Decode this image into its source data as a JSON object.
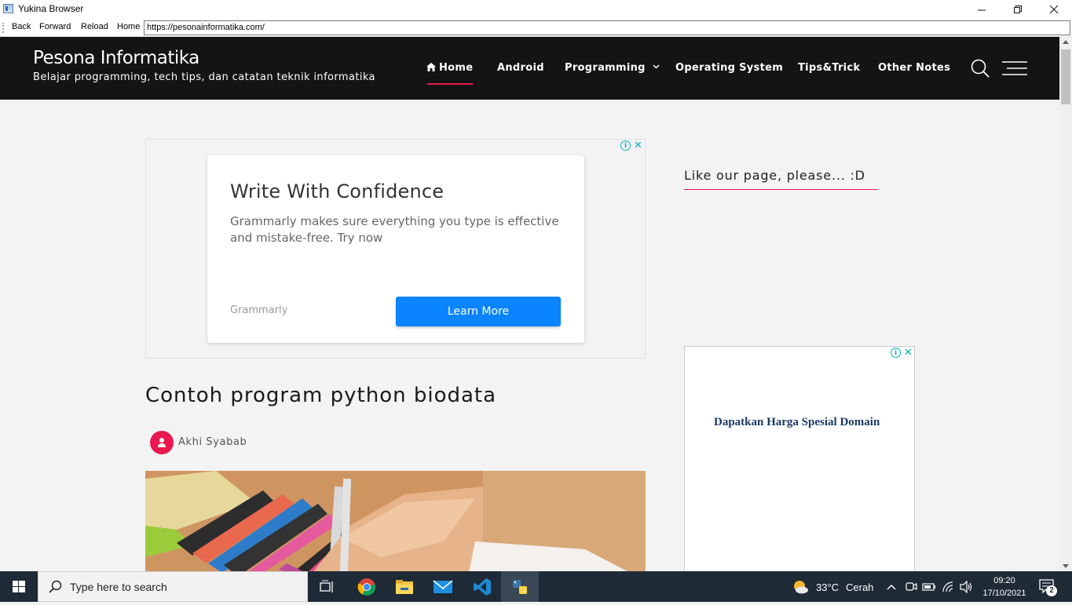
{
  "window": {
    "title": "Yukina Browser",
    "minimize": "—",
    "restore": "❐",
    "close": "✕"
  },
  "toolbar": {
    "back": "Back",
    "forward": "Forward",
    "reload": "Reload",
    "home": "Home",
    "url": "https://pesonainformatika.com/"
  },
  "site": {
    "title": "Pesona Informatika",
    "tagline": "Belajar programming, tech tips, dan catatan teknik informatika",
    "nav": [
      {
        "label": "Home",
        "active": true,
        "icon": "home-icon"
      },
      {
        "label": "Android"
      },
      {
        "label": "Programming",
        "dropdown": true
      },
      {
        "label": "Operating System"
      },
      {
        "label": "Tips&Trick"
      },
      {
        "label": "Other Notes"
      }
    ],
    "accent": "#e8194e"
  },
  "ad": {
    "headline": "Write With Confidence",
    "description": "Grammarly makes sure everything you type is effective and mistake-free. Try now",
    "brand": "Grammarly",
    "cta": "Learn More"
  },
  "post": {
    "title": "Contoh program python biodata",
    "author": "Akhi Syabab"
  },
  "sidebar": {
    "widget_title": "Like our page, please... :D",
    "ad_text": "Dapatkan Harga Spesial Domain"
  },
  "taskbar": {
    "search_placeholder": "Type here to search",
    "weather_temp": "33°C",
    "weather_desc": "Cerah",
    "time": "09:20",
    "date": "17/10/2021",
    "notifications": "2"
  }
}
